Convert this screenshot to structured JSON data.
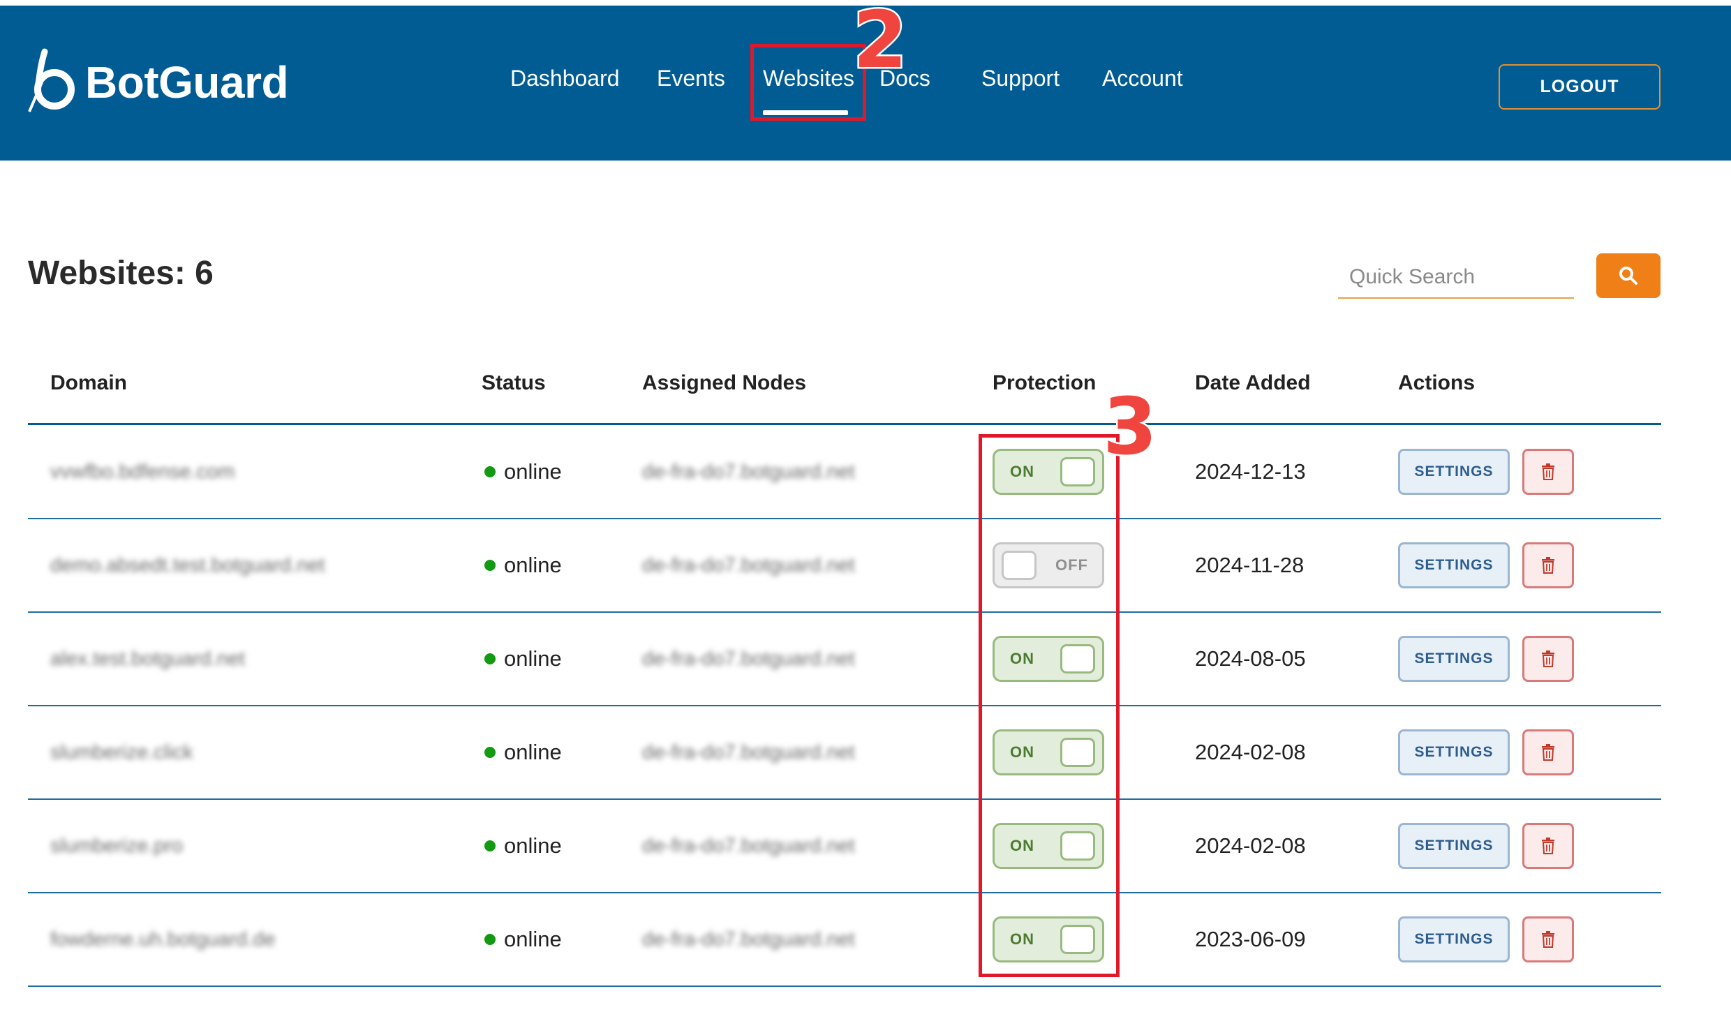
{
  "app": {
    "logo_text": "BotGuard"
  },
  "nav": {
    "items": [
      {
        "label": "Dashboard"
      },
      {
        "label": "Events"
      },
      {
        "label": "Websites",
        "active": true
      },
      {
        "label": "Docs"
      },
      {
        "label": "Support"
      },
      {
        "label": "Account"
      }
    ],
    "logout_label": "LOGOUT"
  },
  "page": {
    "title": "Websites: 6"
  },
  "search": {
    "placeholder": "Quick Search",
    "icon": "search-icon"
  },
  "table": {
    "columns": [
      "Domain",
      "Status",
      "Assigned Nodes",
      "Protection",
      "Date Added",
      "Actions"
    ],
    "rows": [
      {
        "domain": "vvwfbo.bdfense.com",
        "status": "online",
        "nodes": "de-fra-do7.botguard.net",
        "protection": "ON",
        "date": "2024-12-13"
      },
      {
        "domain": "demo.absedt.test.botguard.net",
        "status": "online",
        "nodes": "de-fra-do7.botguard.net",
        "protection": "OFF",
        "date": "2024-11-28"
      },
      {
        "domain": "alex.test.botguard.net",
        "status": "online",
        "nodes": "de-fra-do7.botguard.net",
        "protection": "ON",
        "date": "2024-08-05"
      },
      {
        "domain": "slumberize.click",
        "status": "online",
        "nodes": "de-fra-do7.botguard.net",
        "protection": "ON",
        "date": "2024-02-08"
      },
      {
        "domain": "slumberize.pro",
        "status": "online",
        "nodes": "de-fra-do7.botguard.net",
        "protection": "ON",
        "date": "2024-02-08"
      },
      {
        "domain": "fowderne.uh.botguard.de",
        "status": "online",
        "nodes": "de-fra-do7.botguard.net",
        "protection": "ON",
        "date": "2023-06-09"
      }
    ],
    "settings_label": "SETTINGS",
    "delete_icon": "trash-icon"
  },
  "annotations": {
    "nav_marker": "2",
    "protection_marker": "3"
  },
  "colors": {
    "header_bg": "#005c93",
    "accent_orange": "#ef7f16",
    "status_online": "#129a12",
    "annotation_red": "#e0192a"
  }
}
